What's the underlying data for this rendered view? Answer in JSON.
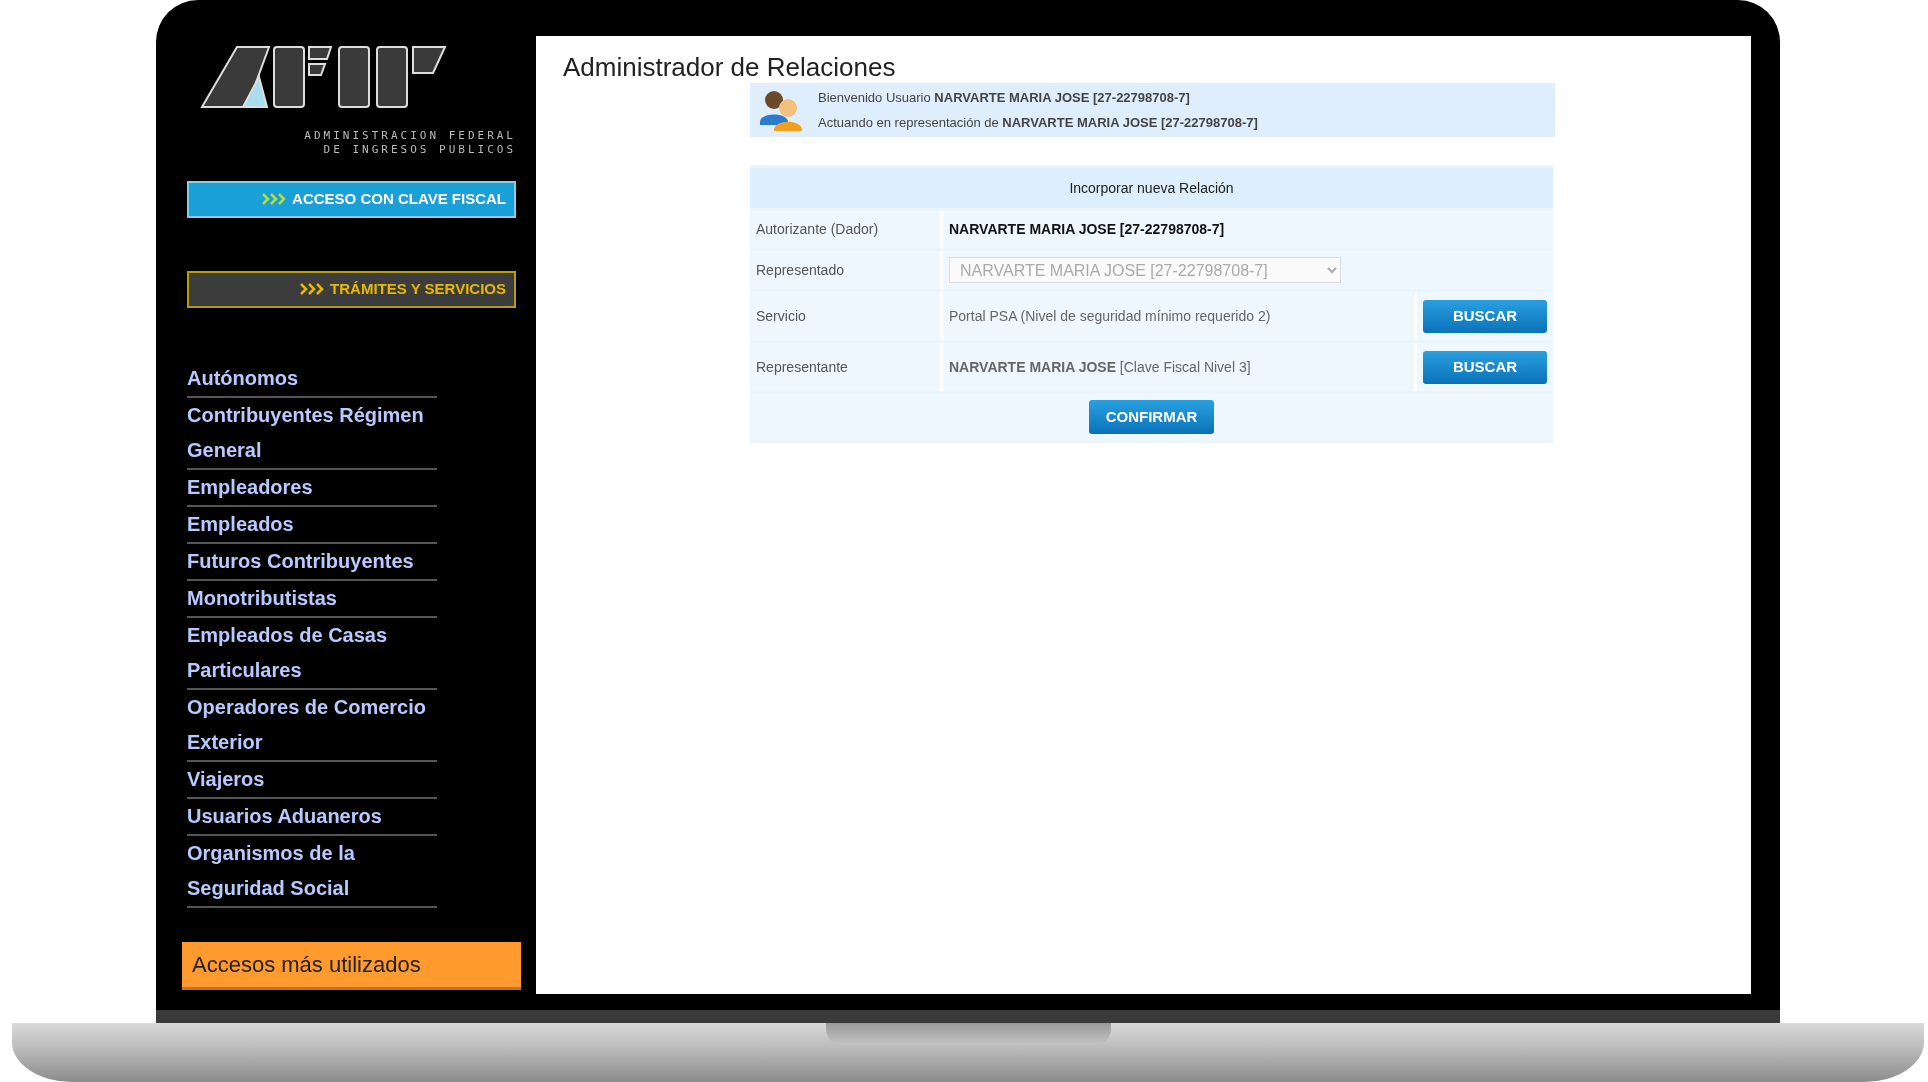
{
  "sidebar": {
    "logo_caption": [
      "ADMINISTRACION FEDERAL",
      "DE INGRESOS PUBLICOS"
    ],
    "buttons": [
      {
        "kind": "primary",
        "label": "ACCESO CON CLAVE FISCAL"
      },
      {
        "kind": "secondary",
        "label": "TRÁMITES Y SERVICIOS"
      }
    ],
    "menu": [
      {
        "label": "Autónomos"
      },
      {
        "label": "Contribuyentes Régimen General"
      },
      {
        "label": "Empleadores"
      },
      {
        "label": "Empleados"
      },
      {
        "label": "Futuros Contribuyentes"
      },
      {
        "label": "Monotributistas"
      },
      {
        "label": "Empleados de Casas Particulares"
      },
      {
        "label": "Operadores de Comercio Exterior"
      },
      {
        "label": "Viajeros"
      },
      {
        "label": "Usuarios Aduaneros"
      },
      {
        "label": "Organismos de la Seguridad Social"
      }
    ],
    "featured": "Accesos más utilizados"
  },
  "main": {
    "title": "Administrador de Relaciones",
    "welcome": [
      "Bienvenido Usuario **NARVARTE MARIA JOSE [27-22798708-7]**",
      "Actuando en representación de **NARVARTE MARIA JOSE [27-22798708-7]**"
    ],
    "form": {
      "heading": "Incorporar nueva Relación",
      "rows": [
        {
          "kind": "text",
          "label": "Autorizante (Dador)",
          "value": "NARVARTE MARIA JOSE [27-22798708-7]"
        },
        {
          "kind": "select",
          "label": "Representado",
          "value": "NARVARTE MARIA JOSE [27-22798708-7]",
          "disabled": true
        },
        {
          "kind": "search",
          "label": "Servicio",
          "value": "Portal PSA (Nivel de seguridad mínimo requerido 2)",
          "button": "BUSCAR"
        },
        {
          "kind": "search",
          "label": "Representante",
          "value": "**NARVARTE MARIA JOSE** [Clave Fiscal Nivel 3]",
          "button": "BUSCAR"
        }
      ],
      "confirm": "CONFIRMAR"
    }
  }
}
